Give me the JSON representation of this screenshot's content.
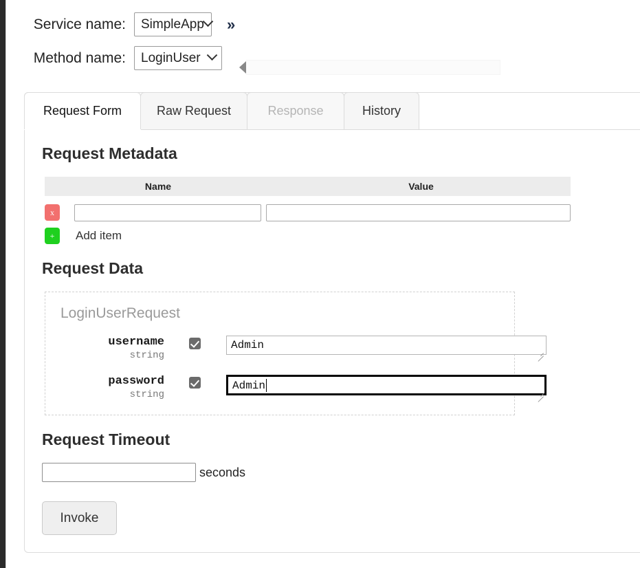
{
  "window": {
    "edge_color": "#2b2b2b"
  },
  "selectors": {
    "service": {
      "label": "Service name:",
      "value": "SimpleApp",
      "expand_marker": "»"
    },
    "method": {
      "label": "Method name:",
      "value": "LoginUser"
    }
  },
  "tabs": [
    {
      "label": "Request Form",
      "state": "active"
    },
    {
      "label": "Raw Request",
      "state": "normal"
    },
    {
      "label": "Response",
      "state": "disabled"
    },
    {
      "label": "History",
      "state": "normal"
    }
  ],
  "metadata": {
    "heading": "Request Metadata",
    "columns": [
      "Name",
      "Value"
    ],
    "rows": [
      {
        "remove_label": "x",
        "name_value": "",
        "name_placeholder": "",
        "value_value": "",
        "value_placeholder": ""
      }
    ],
    "add_button_label": "+",
    "add_item_label": "Add item"
  },
  "request_data": {
    "heading": "Request Data",
    "message_type": "LoginUserRequest",
    "fields": [
      {
        "name": "username",
        "type": "string",
        "checked": true,
        "value": "Admin",
        "focused": false
      },
      {
        "name": "password",
        "type": "string",
        "checked": true,
        "value": "Admin",
        "focused": true
      }
    ]
  },
  "timeout": {
    "heading": "Request Timeout",
    "value": "",
    "placeholder": "",
    "unit_label": "seconds"
  },
  "actions": {
    "invoke_label": "Invoke"
  },
  "colors": {
    "remove_button": "#f2706e",
    "add_button": "#1fd01f",
    "checkbox_fill": "#6b6b6b",
    "table_header_bg": "#ececec",
    "disabled_tab_text": "#b5b5b5",
    "chevron_accent": "#22304a"
  }
}
